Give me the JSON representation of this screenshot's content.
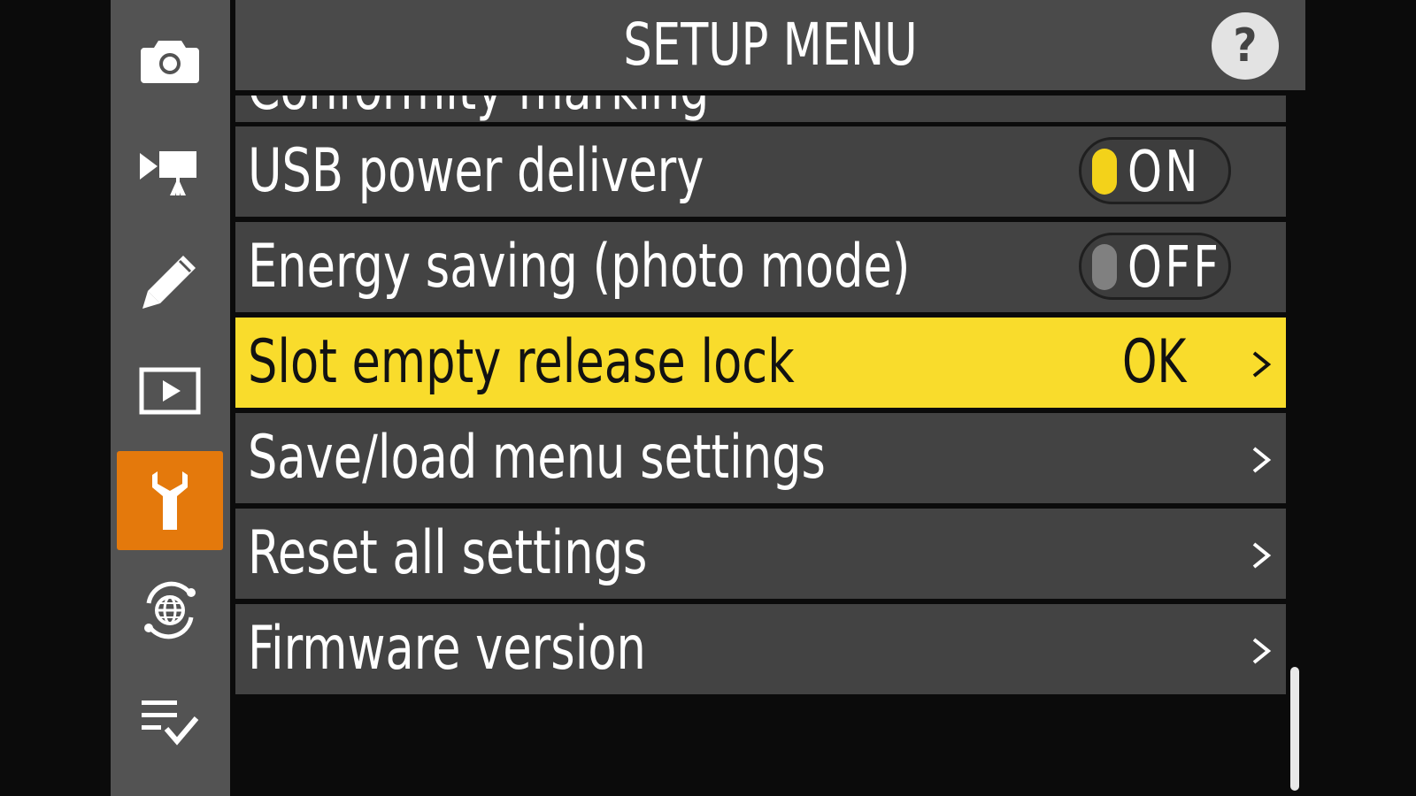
{
  "header": {
    "title": "SETUP MENU",
    "help_label": "?"
  },
  "tabs": [
    {
      "icon": "camera-icon",
      "name": "photo-shooting-menu"
    },
    {
      "icon": "movie-camera-icon",
      "name": "video-recording-menu"
    },
    {
      "icon": "pencil-icon",
      "name": "custom-settings-menu"
    },
    {
      "icon": "playback-icon",
      "name": "playback-menu"
    },
    {
      "icon": "wrench-icon",
      "name": "setup-menu",
      "active": true
    },
    {
      "icon": "network-icon",
      "name": "network-menu"
    },
    {
      "icon": "my-menu-icon",
      "name": "my-menu"
    }
  ],
  "menu": {
    "partial_item": "Conformity marking",
    "items": [
      {
        "label": "USB power delivery",
        "toggle": "ON"
      },
      {
        "label": "Energy saving (photo mode)",
        "toggle": "OFF"
      },
      {
        "label": "Slot empty release lock",
        "value": "OK",
        "selected": true
      },
      {
        "label": "Save/load menu settings"
      },
      {
        "label": "Reset all settings"
      },
      {
        "label": "Firmware version"
      }
    ]
  },
  "colors": {
    "selected_row": "#f9dc2c",
    "active_tab": "#e4790c",
    "toggle_on": "#f3d21a"
  }
}
